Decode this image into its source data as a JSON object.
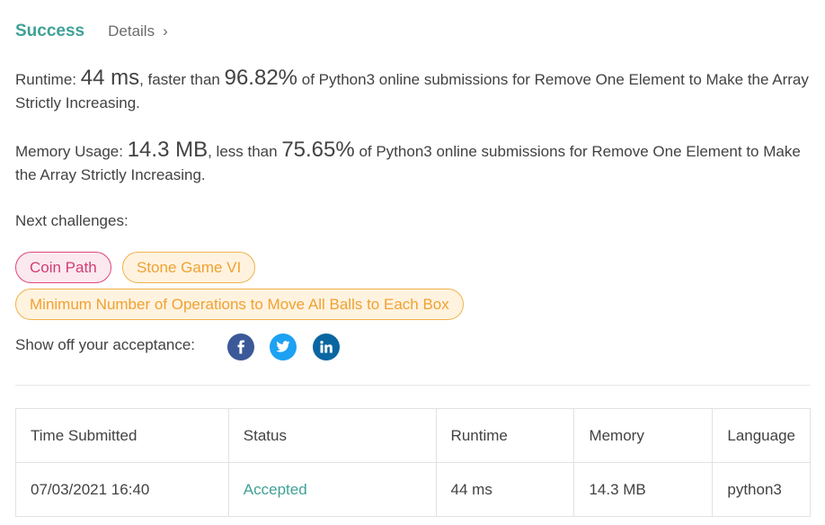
{
  "header": {
    "status_label": "Success",
    "details_label": "Details"
  },
  "runtime": {
    "label": "Runtime: ",
    "value": "44 ms",
    "mid_text": ", faster than ",
    "percent": "96.82%",
    "tail": " of Python3 online submissions for Remove One Element to Make the Array Strictly Increasing."
  },
  "memory": {
    "label": "Memory Usage: ",
    "value": "14.3 MB",
    "mid_text": ", less than ",
    "percent": "75.65%",
    "tail": " of Python3 online submissions for Remove One Element to Make the Array Strictly Increasing."
  },
  "next_challenges": {
    "label": "Next challenges:",
    "items": [
      {
        "title": "Coin Path",
        "difficulty": "hard"
      },
      {
        "title": "Stone Game VI",
        "difficulty": "medium"
      },
      {
        "title": "Minimum Number of Operations to Move All Balls to Each Box",
        "difficulty": "medium"
      }
    ]
  },
  "share": {
    "label": "Show off your acceptance:",
    "icons": [
      "facebook-icon",
      "twitter-icon",
      "linkedin-icon"
    ]
  },
  "submissions": {
    "columns": [
      "Time Submitted",
      "Status",
      "Runtime",
      "Memory",
      "Language"
    ],
    "rows": [
      {
        "time": "07/03/2021 16:40",
        "status": "Accepted",
        "runtime": "44 ms",
        "memory": "14.3 MB",
        "language": "python3"
      }
    ]
  },
  "colors": {
    "accent": "#40a196",
    "hard": "#d23d73",
    "medium": "#f0a132",
    "facebook": "#3b5998",
    "twitter": "#1da1f2",
    "linkedin": "#0a66a1"
  }
}
